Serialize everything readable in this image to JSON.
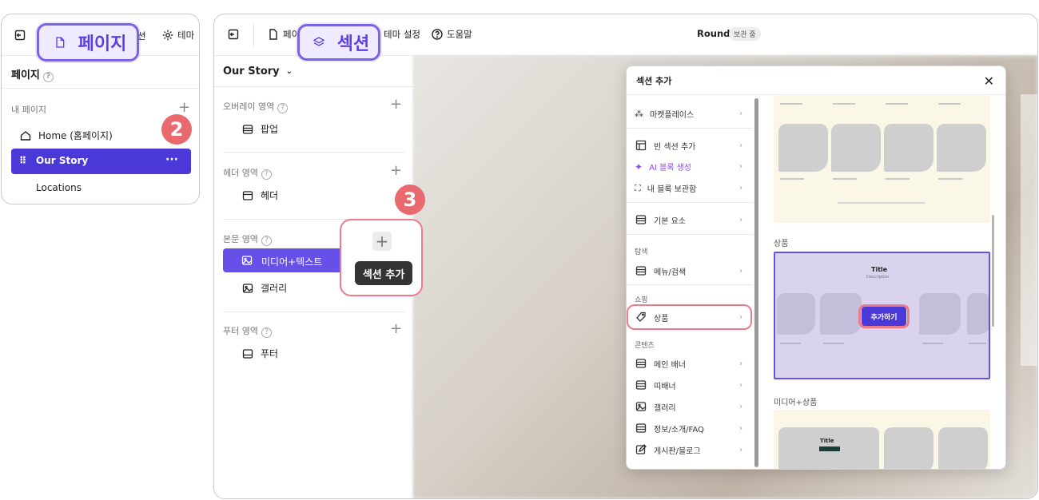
{
  "left_panel": {
    "topbar_partial": [
      "션",
      "테마"
    ],
    "callout_label": "페이지",
    "title": "페이지",
    "help": "?",
    "section_label": "내 페이지",
    "pages": [
      "Home (홈페이지)",
      "Our Story",
      "Locations"
    ],
    "selected_more": "···",
    "badge": "2"
  },
  "main": {
    "topbar": {
      "page_partial": "페이",
      "callout_label": "섹션",
      "theme": "테마 설정",
      "help": "도움말",
      "site_name": "Round",
      "status_badge": "보관 중"
    },
    "page_selector": "Our Story",
    "sections": [
      {
        "label": "오버레이 영역",
        "items": [
          "팝업"
        ]
      },
      {
        "label": "헤더 영역",
        "items": [
          "헤더"
        ]
      },
      {
        "label": "본문 영역",
        "items": [
          "미디어+텍스트",
          "갤러리"
        ]
      },
      {
        "label": "푸터 영역",
        "items": [
          "푸터"
        ]
      }
    ],
    "add_section_tooltip": "섹션 추가",
    "badge": "3"
  },
  "modal": {
    "title": "섹션 추가",
    "menu": [
      {
        "label": "마켓플레이스",
        "icon": "marketplace-icon"
      },
      {
        "label": "빈 섹션 추가",
        "icon": "layout-icon"
      },
      {
        "label": "AI 블록 생성",
        "icon": "sparkle-icon",
        "accent": "#8a4de8"
      },
      {
        "label": "내 블록 보관함",
        "icon": "frame-icon"
      },
      {
        "label": "기본 요소",
        "icon": "square-icon"
      }
    ],
    "categories": [
      {
        "label": "탐색",
        "items": [
          "메뉴/검색"
        ]
      },
      {
        "label": "쇼핑",
        "items": [
          "상품"
        ]
      },
      {
        "label": "콘텐츠",
        "items": [
          "메인 배너",
          "띠배너",
          "갤러리",
          "정보/소개/FAQ",
          "게시판/블로그"
        ]
      }
    ],
    "preview_groups": [
      "상품",
      "미디어+상품"
    ],
    "preview_title": "Title",
    "preview_desc": "Description",
    "add_button": "추가하기",
    "accent": "#4b38d8"
  }
}
